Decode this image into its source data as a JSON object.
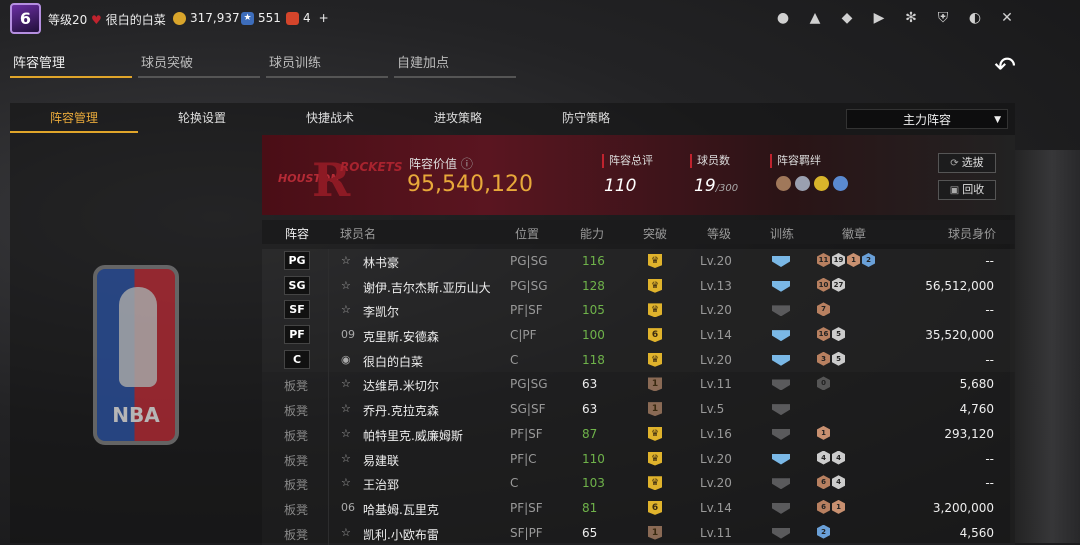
{
  "topbar": {
    "avatar_level": "6",
    "level": "等级20",
    "username": "很白的白菜",
    "coins": "317,937",
    "points": "551",
    "tickets": "4",
    "plus": "+"
  },
  "main_tabs": [
    "阵容管理",
    "球员突破",
    "球员训练",
    "自建加点"
  ],
  "sub_tabs": [
    "阵容管理",
    "轮换设置",
    "快捷战术",
    "进攻策略",
    "防守策略"
  ],
  "lineup_select": "主力阵容",
  "team": {
    "logo_text_left": "HOUSTON",
    "logo_text_right": "ROCKETS",
    "value_label": "阵容价值",
    "value": "95,540,120",
    "rating_label": "阵容总评",
    "rating": "110",
    "count_label": "球员数",
    "count": "19",
    "count_max": "/300",
    "chem_label": "阵容羁绊"
  },
  "buttons": {
    "pick": "选拔",
    "recycle": "回收"
  },
  "columns": [
    "阵容",
    "球员名",
    "位置",
    "能力",
    "突破",
    "等级",
    "训练",
    "徽章",
    "球员身价"
  ],
  "players": [
    {
      "slot": "PG",
      "num": "",
      "name": "林书豪",
      "pos": "PG|SG",
      "ovr": "116",
      "ovr_color": "green",
      "brk": "gold",
      "lv": "Lv.20",
      "train": "blue",
      "badges": [
        "11",
        "19",
        "1",
        "2"
      ],
      "price": "--"
    },
    {
      "slot": "SG",
      "num": "",
      "name": "谢伊.吉尔杰斯.亚历山大",
      "pos": "PG|SG",
      "ovr": "128",
      "ovr_color": "green",
      "brk": "gold",
      "lv": "Lv.13",
      "train": "blue",
      "badges": [
        "10",
        "27"
      ],
      "price": "56,512,000"
    },
    {
      "slot": "SF",
      "num": "",
      "name": "李凯尔",
      "pos": "PF|SF",
      "ovr": "105",
      "ovr_color": "green",
      "brk": "gold",
      "lv": "Lv.20",
      "train": "grey",
      "badges": [
        "7"
      ],
      "price": "--"
    },
    {
      "slot": "PF",
      "num": "09",
      "name": "克里斯.安德森",
      "pos": "C|PF",
      "ovr": "100",
      "ovr_color": "green",
      "brk": "6",
      "lv": "Lv.14",
      "train": "blue",
      "badges": [
        "16",
        "5"
      ],
      "price": "35,520,000"
    },
    {
      "slot": "C",
      "num": "",
      "name": "很白的白菜",
      "pos": "C",
      "ovr": "118",
      "ovr_color": "green",
      "brk": "gold",
      "lv": "Lv.20",
      "train": "blue",
      "badges": [
        "3",
        "5"
      ],
      "price": "--"
    },
    {
      "slot": "板凳",
      "num": "",
      "name": "达维昂.米切尔",
      "pos": "PG|SG",
      "ovr": "63",
      "ovr_color": "white",
      "brk": "1",
      "lv": "Lv.11",
      "train": "grey",
      "badges": [
        "0"
      ],
      "price": "5,680"
    },
    {
      "slot": "板凳",
      "num": "",
      "name": "乔丹.克拉克森",
      "pos": "SG|SF",
      "ovr": "63",
      "ovr_color": "white",
      "brk": "1",
      "lv": "Lv.5",
      "train": "grey",
      "badges": [],
      "price": "4,760"
    },
    {
      "slot": "板凳",
      "num": "",
      "name": "帕特里克.威廉姆斯",
      "pos": "PF|SF",
      "ovr": "87",
      "ovr_color": "green",
      "brk": "gold",
      "lv": "Lv.16",
      "train": "grey",
      "badges": [
        "1"
      ],
      "price": "293,120"
    },
    {
      "slot": "板凳",
      "num": "",
      "name": "易建联",
      "pos": "PF|C",
      "ovr": "110",
      "ovr_color": "green",
      "brk": "gold",
      "lv": "Lv.20",
      "train": "blue",
      "badges": [
        "4",
        "4"
      ],
      "price": "--"
    },
    {
      "slot": "板凳",
      "num": "",
      "name": "王治郅",
      "pos": "C",
      "ovr": "103",
      "ovr_color": "green",
      "brk": "gold",
      "lv": "Lv.20",
      "train": "grey",
      "badges": [
        "6",
        "4"
      ],
      "price": "--"
    },
    {
      "slot": "板凳",
      "num": "06",
      "name": "哈基姆.瓦里克",
      "pos": "PF|SF",
      "ovr": "81",
      "ovr_color": "green",
      "brk": "6",
      "lv": "Lv.14",
      "train": "grey",
      "badges": [
        "6",
        "1"
      ],
      "price": "3,200,000"
    },
    {
      "slot": "板凳",
      "num": "",
      "name": "凯利.小欧布雷",
      "pos": "SF|PF",
      "ovr": "65",
      "ovr_color": "white",
      "brk": "1",
      "lv": "Lv.11",
      "train": "grey",
      "badges": [
        "2"
      ],
      "price": "4,560"
    }
  ],
  "colors": {
    "accent": "#e0a52a",
    "green": "#6fb34a",
    "red": "#c0232e"
  }
}
